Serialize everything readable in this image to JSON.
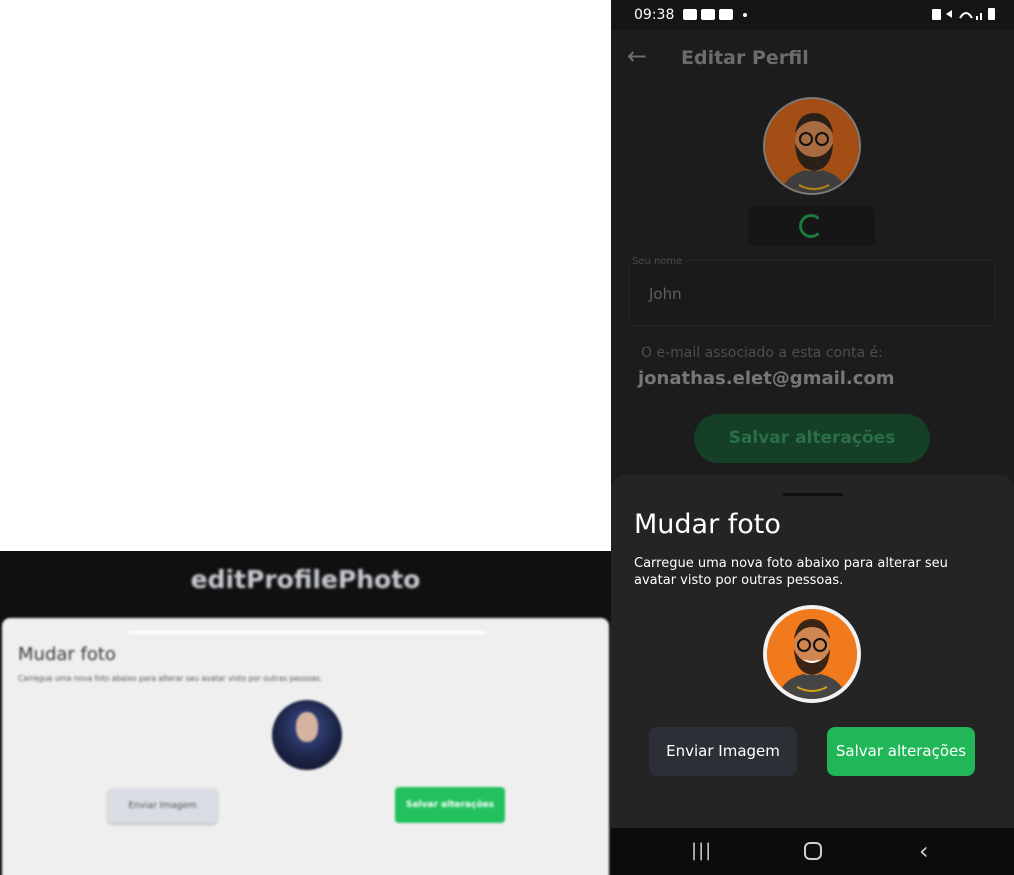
{
  "mockup": {
    "title": "editProfilePhoto",
    "sheet_title": "Mudar foto",
    "sheet_subtitle": "Carregue uma nova foto abaixo para alterar seu avatar visto por outras pessoas.",
    "send_button": "Enviar Imagem",
    "save_button": "Salvar alterações"
  },
  "phone": {
    "status_bar": {
      "time": "09:38"
    },
    "header": {
      "title": "Editar Perfil"
    },
    "name_field": {
      "label": "Seu nome",
      "value": "John"
    },
    "email": {
      "label": "O e-mail associado a esta conta é:",
      "value": "jonathas.elet@gmail.com"
    },
    "background_save_button": "Salvar alterações",
    "sheet": {
      "title": "Mudar foto",
      "subtitle": "Carregue uma nova foto abaixo para alterar seu avatar visto por outras pessoas.",
      "send_button": "Enviar Imagem",
      "save_button": "Salvar alterações"
    }
  },
  "colors": {
    "accent_green": "#21b657",
    "sheet_background": "#242424",
    "avatar_orange": "#f07a1c"
  },
  "icons": [
    "back-arrow-icon",
    "gallery-icon",
    "youtube-icon",
    "wifi-icon",
    "battery-icon",
    "recent-apps-icon",
    "home-icon",
    "nav-back-icon"
  ]
}
